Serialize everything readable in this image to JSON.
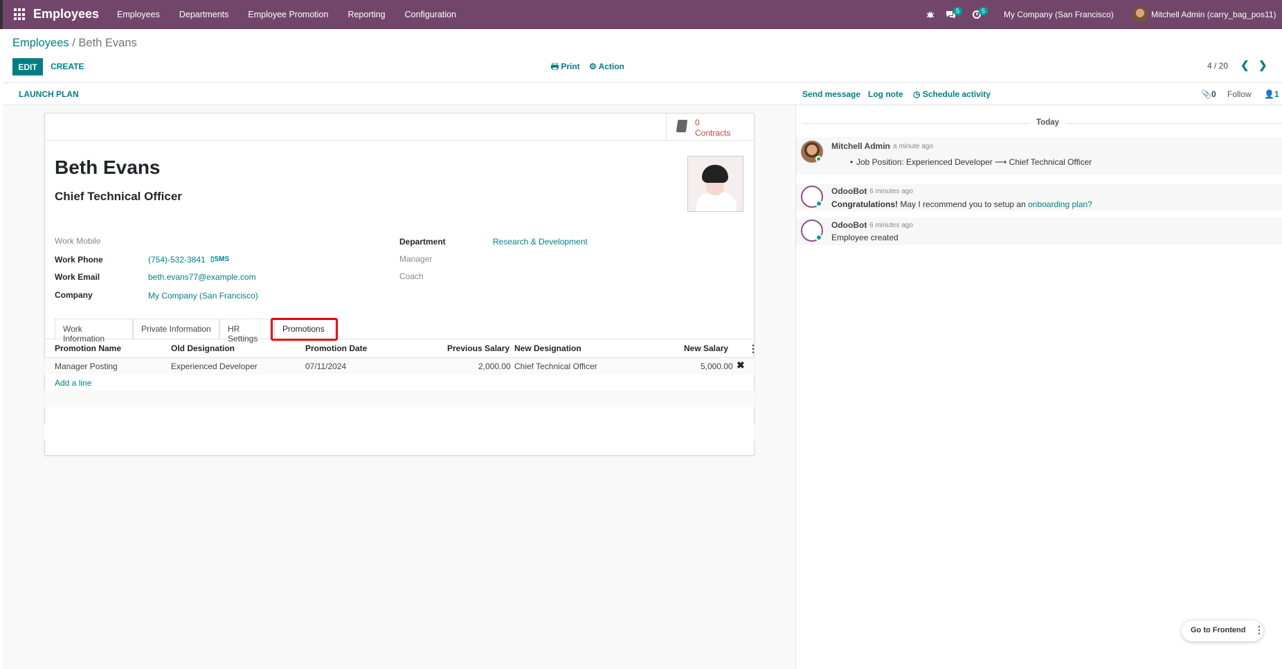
{
  "navbar": {
    "app_title": "Employees",
    "menu": [
      "Employees",
      "Departments",
      "Employee Promotion",
      "Reporting",
      "Configuration"
    ],
    "messages_count": "5",
    "activities_count": "5",
    "company": "My Company (San Francisco)",
    "user": "Mitchell Admin (carry_bag_pos11)",
    "bar_color": "#71466a"
  },
  "control_panel": {
    "breadcrumb_root": "Employees",
    "breadcrumb_sep": " / ",
    "breadcrumb_current": "Beth Evans",
    "edit_label": "EDIT",
    "create_label": "CREATE",
    "print_label": "Print",
    "action_label": "Action",
    "pager": "4 / 20"
  },
  "statusbar": {
    "launch_plan": "LAUNCH PLAN"
  },
  "smart_button": {
    "value": "0",
    "label": "Contracts"
  },
  "employee": {
    "name": "Beth Evans",
    "job_title": "Chief Technical Officer",
    "fields_left": [
      {
        "label": "Work Mobile",
        "value": ""
      },
      {
        "label": "Work Phone",
        "value": "(754)-532-3841"
      },
      {
        "label": "Work Email",
        "value": "beth.evans77@example.com"
      },
      {
        "label": "Company",
        "value": "My Company (San Francisco)"
      }
    ],
    "sms_label": "SMS",
    "fields_right": [
      {
        "label": "Department",
        "value": "Research & Development"
      },
      {
        "label": "Manager",
        "value": ""
      },
      {
        "label": "Coach",
        "value": ""
      }
    ]
  },
  "tabs": [
    "Work Information",
    "Private Information",
    "HR Settings",
    "Promotions"
  ],
  "active_tab": "Promotions",
  "promotions_table": {
    "columns": [
      "Promotion Name",
      "Old Designation",
      "Promotion Date",
      "Previous Salary",
      "New Designation",
      "New Salary"
    ],
    "rows": [
      [
        "Manager Posting",
        "Experienced Developer",
        "07/11/2024",
        "2,000.00",
        "Chief Technical Officer",
        "5,000.00"
      ]
    ],
    "add_line": "Add a line"
  },
  "chatter": {
    "send_message": "Send message",
    "log_note": "Log note",
    "schedule_activity": "Schedule activity",
    "attachments": "0",
    "follow": "Follow",
    "followers": "1",
    "date_separator": "Today",
    "messages": [
      {
        "author": "Mitchell Admin",
        "when": "- a minute ago",
        "body": "Job Position: Experienced Developer ⟶ Chief Technical Officer"
      },
      {
        "author": "OdooBot",
        "when": "- 6 minutes ago",
        "body_bold": "Congratulations!",
        "body": " May I recommend you to setup an ",
        "link": "onboarding plan?"
      },
      {
        "author": "OdooBot",
        "when": "- 6 minutes ago",
        "body": "Employee created"
      }
    ]
  },
  "go_frontend": "Go to Frontend"
}
